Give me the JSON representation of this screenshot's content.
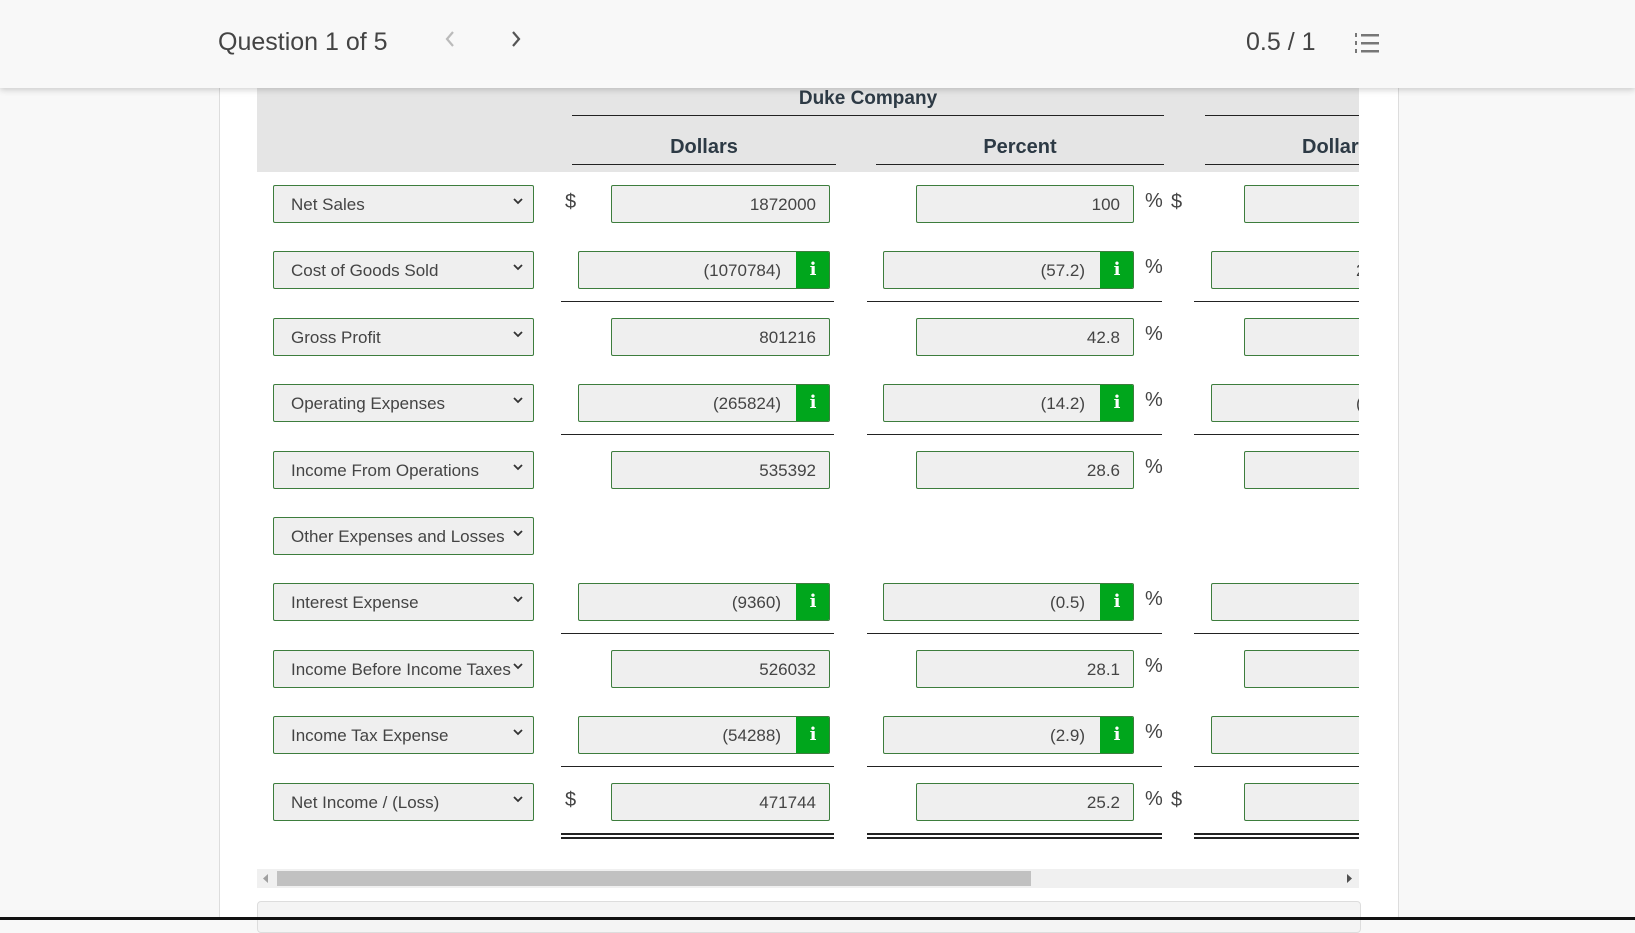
{
  "header": {
    "question_label": "Question 1 of 5",
    "score": "0.5 / 1",
    "prev_icon": "chevron-left",
    "next_icon": "chevron-right",
    "list_icon": "numbered-list"
  },
  "table": {
    "company": "Duke Company",
    "columns": [
      "Dollars",
      "Percent",
      "Dollar"
    ],
    "currency_symbol": "$",
    "percent_symbol": "%",
    "info_glyph": "i",
    "rows": [
      {
        "label": "Net Sales",
        "dollars": "1872000",
        "percent": "100",
        "info": false,
        "dollar_sign": true,
        "underline": "none",
        "col3": ""
      },
      {
        "label": "Cost of Goods Sold",
        "dollars": "(1070784)",
        "percent": "(57.2)",
        "info": true,
        "dollar_sign": false,
        "underline": "single",
        "col3": "2"
      },
      {
        "label": "Gross Profit",
        "dollars": "801216",
        "percent": "42.8",
        "info": false,
        "dollar_sign": false,
        "underline": "none",
        "col3": ""
      },
      {
        "label": "Operating Expenses",
        "dollars": "(265824)",
        "percent": "(14.2)",
        "info": true,
        "dollar_sign": false,
        "underline": "single",
        "col3": "("
      },
      {
        "label": "Income From Operations",
        "dollars": "535392",
        "percent": "28.6",
        "info": false,
        "dollar_sign": false,
        "underline": "none",
        "col3": ""
      },
      {
        "label": "Other Expenses and Losses",
        "header_only": true
      },
      {
        "label": "Interest Expense",
        "dollars": "(9360)",
        "percent": "(0.5)",
        "info": true,
        "dollar_sign": false,
        "underline": "single",
        "col3": ""
      },
      {
        "label": "Income Before Income Taxes",
        "dollars": "526032",
        "percent": "28.1",
        "info": false,
        "dollar_sign": false,
        "underline": "none",
        "col3": ""
      },
      {
        "label": "Income Tax Expense",
        "dollars": "(54288)",
        "percent": "(2.9)",
        "info": true,
        "dollar_sign": false,
        "underline": "single",
        "col3": ""
      },
      {
        "label": "Net Income / (Loss)",
        "dollars": "471744",
        "percent": "25.2",
        "info": false,
        "dollar_sign": true,
        "underline": "double",
        "col3": ""
      }
    ]
  },
  "colors": {
    "info_button": "#00a61c",
    "input_border": "#3d7d3d",
    "input_bg": "#efefef"
  }
}
